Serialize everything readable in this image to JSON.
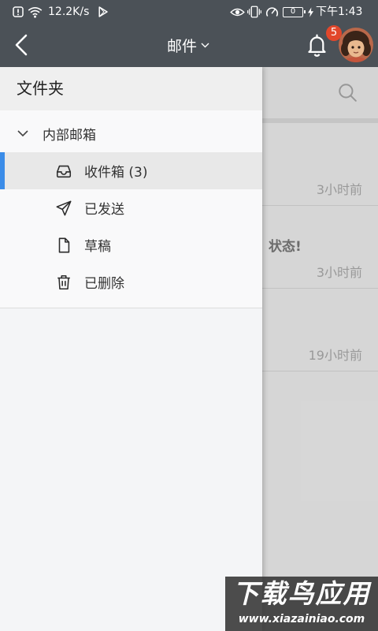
{
  "theme": {
    "header_bg": "#4b5157",
    "accent": "#3b8ce8",
    "badge": "#e2472b"
  },
  "status_bar": {
    "network_speed": "12.2K/s",
    "battery": "0",
    "time": "下午1:43",
    "icons_left": [
      "notification-alert-icon",
      "wifi-icon",
      "play-store-icon"
    ],
    "icons_right": [
      "eye-icon",
      "vibrate-icon",
      "speed-gauge-icon",
      "battery-icon",
      "charging-bolt-icon"
    ]
  },
  "header": {
    "title": "邮件",
    "notification_count": "5"
  },
  "drawer": {
    "title": "文件夹",
    "group": {
      "label": "内部邮箱",
      "expanded": true,
      "folders": [
        {
          "label": "收件箱 (3)",
          "icon": "inbox-icon",
          "selected": true
        },
        {
          "label": "已发送",
          "icon": "send-icon",
          "selected": false
        },
        {
          "label": "草稿",
          "icon": "draft-icon",
          "selected": false
        },
        {
          "label": "已删除",
          "icon": "trash-icon",
          "selected": false
        }
      ]
    }
  },
  "mail_list": {
    "items": [
      {
        "time": "3小时前"
      },
      {
        "snippet": "状态!",
        "time": "3小时前"
      },
      {
        "time": "19小时前"
      }
    ]
  },
  "watermark": {
    "brand": "下载鸟应用",
    "url": "www.xiazainiao.com"
  }
}
